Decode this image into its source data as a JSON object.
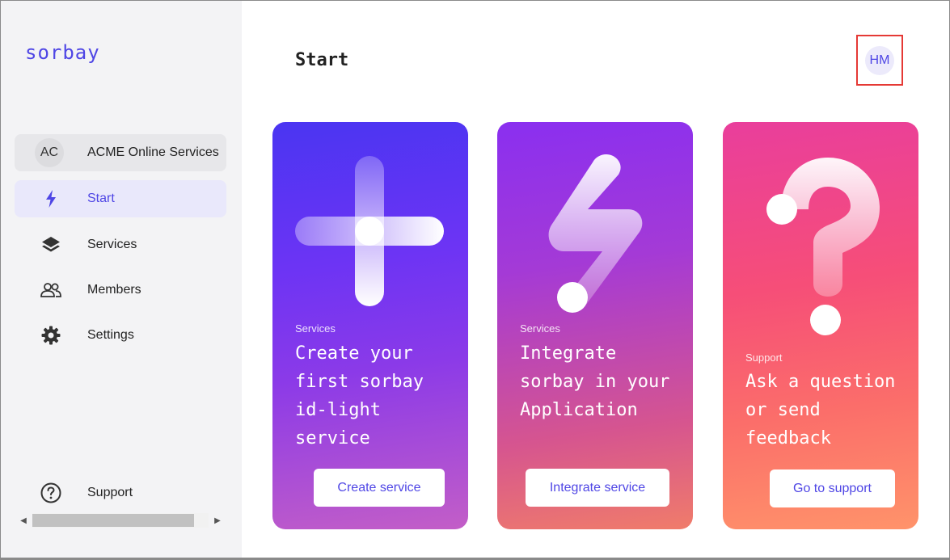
{
  "app": {
    "logo": "sorbay"
  },
  "sidebar": {
    "org": {
      "initials": "AC",
      "name": "ACME Online Services"
    },
    "items": [
      {
        "label": "Start",
        "icon": "bolt-icon",
        "active": true
      },
      {
        "label": "Services",
        "icon": "layers-icon",
        "active": false
      },
      {
        "label": "Members",
        "icon": "users-icon",
        "active": false
      },
      {
        "label": "Settings",
        "icon": "gear-icon",
        "active": false
      }
    ],
    "support": {
      "label": "Support",
      "icon": "help-circle-icon"
    }
  },
  "header": {
    "title": "Start",
    "user_initials": "HM"
  },
  "cards": [
    {
      "category": "Services",
      "title": "Create your first sorbay id-light service",
      "button": "Create service",
      "art": "plus-art"
    },
    {
      "category": "Services",
      "title": "Integrate sorbay in your Application",
      "button": "Integrate service",
      "art": "lightning-art"
    },
    {
      "category": "Support",
      "title": "Ask a question or send feedback",
      "button": "Go to support",
      "art": "question-mark-art"
    }
  ],
  "colors": {
    "accent": "#4f46e5",
    "sidebar_bg": "#f3f3f5",
    "active_bg": "#e9e8fb",
    "highlight": "#e53935"
  }
}
